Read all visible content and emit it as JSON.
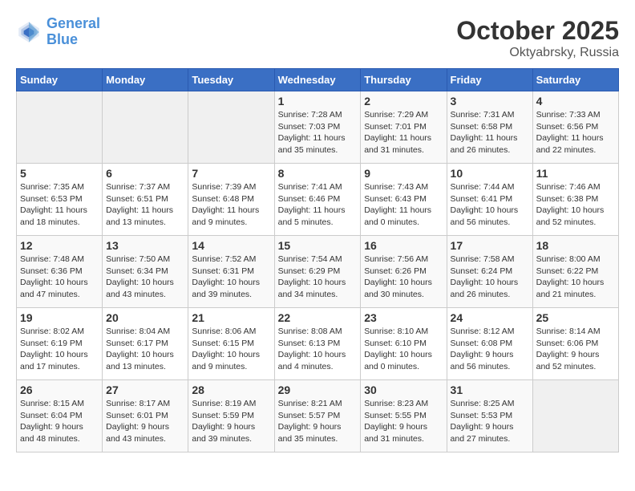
{
  "header": {
    "logo_line1": "General",
    "logo_line2": "Blue",
    "month_year": "October 2025",
    "location": "Oktyabrsky, Russia"
  },
  "weekdays": [
    "Sunday",
    "Monday",
    "Tuesday",
    "Wednesday",
    "Thursday",
    "Friday",
    "Saturday"
  ],
  "weeks": [
    [
      {
        "day": "",
        "info": ""
      },
      {
        "day": "",
        "info": ""
      },
      {
        "day": "",
        "info": ""
      },
      {
        "day": "1",
        "info": "Sunrise: 7:28 AM\nSunset: 7:03 PM\nDaylight: 11 hours and 35 minutes."
      },
      {
        "day": "2",
        "info": "Sunrise: 7:29 AM\nSunset: 7:01 PM\nDaylight: 11 hours and 31 minutes."
      },
      {
        "day": "3",
        "info": "Sunrise: 7:31 AM\nSunset: 6:58 PM\nDaylight: 11 hours and 26 minutes."
      },
      {
        "day": "4",
        "info": "Sunrise: 7:33 AM\nSunset: 6:56 PM\nDaylight: 11 hours and 22 minutes."
      }
    ],
    [
      {
        "day": "5",
        "info": "Sunrise: 7:35 AM\nSunset: 6:53 PM\nDaylight: 11 hours and 18 minutes."
      },
      {
        "day": "6",
        "info": "Sunrise: 7:37 AM\nSunset: 6:51 PM\nDaylight: 11 hours and 13 minutes."
      },
      {
        "day": "7",
        "info": "Sunrise: 7:39 AM\nSunset: 6:48 PM\nDaylight: 11 hours and 9 minutes."
      },
      {
        "day": "8",
        "info": "Sunrise: 7:41 AM\nSunset: 6:46 PM\nDaylight: 11 hours and 5 minutes."
      },
      {
        "day": "9",
        "info": "Sunrise: 7:43 AM\nSunset: 6:43 PM\nDaylight: 11 hours and 0 minutes."
      },
      {
        "day": "10",
        "info": "Sunrise: 7:44 AM\nSunset: 6:41 PM\nDaylight: 10 hours and 56 minutes."
      },
      {
        "day": "11",
        "info": "Sunrise: 7:46 AM\nSunset: 6:38 PM\nDaylight: 10 hours and 52 minutes."
      }
    ],
    [
      {
        "day": "12",
        "info": "Sunrise: 7:48 AM\nSunset: 6:36 PM\nDaylight: 10 hours and 47 minutes."
      },
      {
        "day": "13",
        "info": "Sunrise: 7:50 AM\nSunset: 6:34 PM\nDaylight: 10 hours and 43 minutes."
      },
      {
        "day": "14",
        "info": "Sunrise: 7:52 AM\nSunset: 6:31 PM\nDaylight: 10 hours and 39 minutes."
      },
      {
        "day": "15",
        "info": "Sunrise: 7:54 AM\nSunset: 6:29 PM\nDaylight: 10 hours and 34 minutes."
      },
      {
        "day": "16",
        "info": "Sunrise: 7:56 AM\nSunset: 6:26 PM\nDaylight: 10 hours and 30 minutes."
      },
      {
        "day": "17",
        "info": "Sunrise: 7:58 AM\nSunset: 6:24 PM\nDaylight: 10 hours and 26 minutes."
      },
      {
        "day": "18",
        "info": "Sunrise: 8:00 AM\nSunset: 6:22 PM\nDaylight: 10 hours and 21 minutes."
      }
    ],
    [
      {
        "day": "19",
        "info": "Sunrise: 8:02 AM\nSunset: 6:19 PM\nDaylight: 10 hours and 17 minutes."
      },
      {
        "day": "20",
        "info": "Sunrise: 8:04 AM\nSunset: 6:17 PM\nDaylight: 10 hours and 13 minutes."
      },
      {
        "day": "21",
        "info": "Sunrise: 8:06 AM\nSunset: 6:15 PM\nDaylight: 10 hours and 9 minutes."
      },
      {
        "day": "22",
        "info": "Sunrise: 8:08 AM\nSunset: 6:13 PM\nDaylight: 10 hours and 4 minutes."
      },
      {
        "day": "23",
        "info": "Sunrise: 8:10 AM\nSunset: 6:10 PM\nDaylight: 10 hours and 0 minutes."
      },
      {
        "day": "24",
        "info": "Sunrise: 8:12 AM\nSunset: 6:08 PM\nDaylight: 9 hours and 56 minutes."
      },
      {
        "day": "25",
        "info": "Sunrise: 8:14 AM\nSunset: 6:06 PM\nDaylight: 9 hours and 52 minutes."
      }
    ],
    [
      {
        "day": "26",
        "info": "Sunrise: 8:15 AM\nSunset: 6:04 PM\nDaylight: 9 hours and 48 minutes."
      },
      {
        "day": "27",
        "info": "Sunrise: 8:17 AM\nSunset: 6:01 PM\nDaylight: 9 hours and 43 minutes."
      },
      {
        "day": "28",
        "info": "Sunrise: 8:19 AM\nSunset: 5:59 PM\nDaylight: 9 hours and 39 minutes."
      },
      {
        "day": "29",
        "info": "Sunrise: 8:21 AM\nSunset: 5:57 PM\nDaylight: 9 hours and 35 minutes."
      },
      {
        "day": "30",
        "info": "Sunrise: 8:23 AM\nSunset: 5:55 PM\nDaylight: 9 hours and 31 minutes."
      },
      {
        "day": "31",
        "info": "Sunrise: 8:25 AM\nSunset: 5:53 PM\nDaylight: 9 hours and 27 minutes."
      },
      {
        "day": "",
        "info": ""
      }
    ]
  ]
}
